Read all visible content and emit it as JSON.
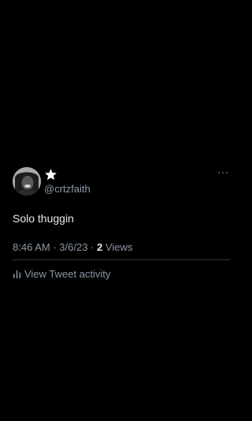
{
  "tweet": {
    "author": {
      "handle": "@crtzfaith",
      "avatar_icon": "user-avatar",
      "badge_icon": "star-icon"
    },
    "more_icon": "more-horizontal-icon",
    "text": "Solo thuggin",
    "meta": {
      "time": "8:46 AM",
      "separator": "·",
      "date": "3/6/23",
      "views_count": "2",
      "views_label": "Views"
    },
    "activity": {
      "icon": "bar-chart-icon",
      "label": "View Tweet activity"
    }
  },
  "colors": {
    "background": "#000000",
    "primary_text": "#e7e9ea",
    "secondary_text": "#8b98a5",
    "divider": "#2f3336"
  }
}
